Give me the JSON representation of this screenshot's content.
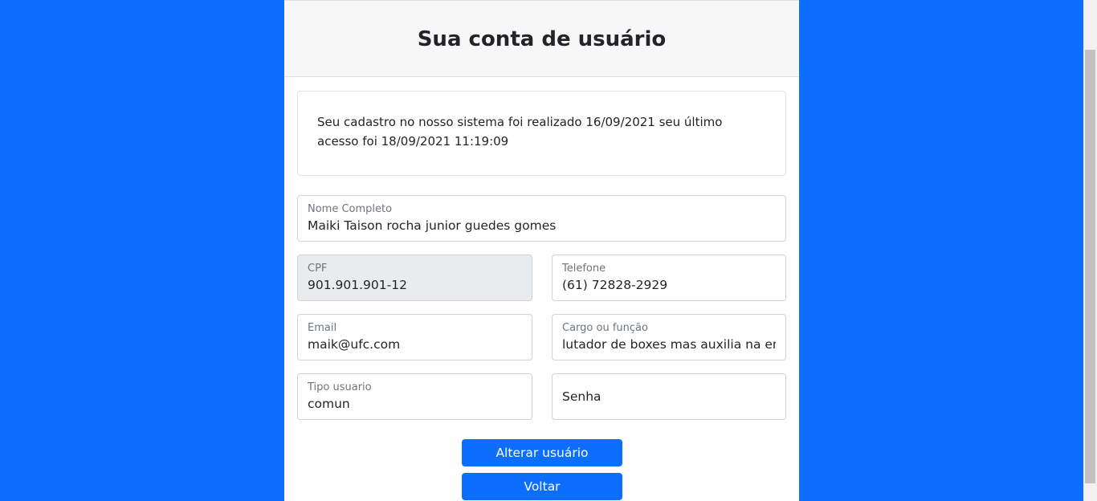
{
  "header": {
    "title": "Sua conta de usuário"
  },
  "info": {
    "text": "Seu cadastro no nosso sistema foi realizado 16/09/2021 seu último acesso foi 18/09/2021 11:19:09"
  },
  "form": {
    "nome": {
      "label": "Nome Completo",
      "value": "Maiki Taison rocha junior guedes gomes"
    },
    "cpf": {
      "label": "CPF",
      "value": "901.901.901-12"
    },
    "telefone": {
      "label": "Telefone",
      "value": "(61) 72828-2929"
    },
    "email": {
      "label": "Email",
      "value": "maik@ufc.com"
    },
    "cargo": {
      "label": "Cargo ou função",
      "value": "lutador de boxes mas auxilia na entreg"
    },
    "tipo": {
      "label": "Tipo usuario",
      "value": "comun"
    },
    "senha": {
      "placeholder": "Senha"
    }
  },
  "buttons": {
    "alterar": "Alterar usuário",
    "voltar": "Voltar"
  },
  "colors": {
    "background": "#0d6efd",
    "primary": "#0d6efd",
    "card_header": "#f7f7f7"
  }
}
